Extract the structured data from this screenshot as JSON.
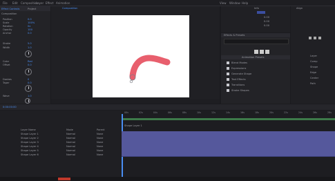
{
  "menu": {
    "items": [
      "File",
      "Edit",
      "Composition",
      "Layer",
      "Effect",
      "Animation",
      "View",
      "Window",
      "Help"
    ]
  },
  "project": {
    "tabs": [
      "Effect Controls",
      "Project"
    ],
    "comp_label": "Composition",
    "properties": [
      {
        "name": "Position",
        "value": "0.0"
      },
      {
        "name": "Scale",
        "value": "100%"
      },
      {
        "name": "Rotation",
        "value": "0x"
      },
      {
        "name": "Opacity",
        "value": "100"
      },
      {
        "name": "Anchor",
        "value": "0.0"
      },
      {
        "name": "Stroke",
        "value": "5.0"
      },
      {
        "name": "Width",
        "value": "1.0"
      },
      {
        "name": "Color",
        "value": "Red"
      },
      {
        "name": "Offset",
        "value": "0.0"
      },
      {
        "name": "Dashes",
        "value": "0"
      },
      {
        "name": "Taper",
        "value": "0.0"
      },
      {
        "name": "Wave",
        "value": "1.0"
      },
      {
        "name": "Angle",
        "value": "0x"
      },
      {
        "name": "Start",
        "value": "0.0"
      },
      {
        "name": "End",
        "value": "100"
      }
    ]
  },
  "viewer": {
    "tab": "Composition"
  },
  "right_panel": {
    "title": "Effects & Presets",
    "search_placeholder": "",
    "section": "Animation Presets",
    "items": [
      "Blend Modes",
      "Expressions",
      "Generate Shape",
      "Text Effects",
      "Transitions",
      "Stroke Shapes"
    ]
  },
  "info_panel": {
    "title": "Info",
    "values": [
      "0.00",
      "0.00",
      "0.00"
    ]
  },
  "preview_panel": {
    "title": "Align",
    "items": [
      "Layer",
      "Comp",
      "Shape",
      "Edge",
      "Center",
      "Path"
    ]
  },
  "timeline": {
    "time": "0:00:00:00",
    "columns": [
      "Layer Name",
      "Mode",
      "Parent"
    ],
    "layers": [
      {
        "name": "Shape Layer 1",
        "mode": "Normal",
        "parent": "None"
      },
      {
        "name": "Shape Layer 2",
        "mode": "Normal",
        "parent": "None"
      },
      {
        "name": "Shape Layer 3",
        "mode": "Normal",
        "parent": "None"
      },
      {
        "name": "Shape Layer 4",
        "mode": "Normal",
        "parent": "None"
      },
      {
        "name": "Shape Layer 5",
        "mode": "Normal",
        "parent": "None"
      },
      {
        "name": "Shape Layer 6",
        "mode": "Normal",
        "parent": "None"
      }
    ],
    "ruler": [
      "00s",
      "02s",
      "04s",
      "06s",
      "08s",
      "10s",
      "12s",
      "14s",
      "16s",
      "18s",
      "20s",
      "22s",
      "24s",
      "26s",
      "28s"
    ],
    "work_area_label": "Shape Layer 1"
  },
  "colors": {
    "accent": "#4a8ff5",
    "shape": "#e85f6d",
    "track": "#55589c",
    "work_area": "#3d7a4a"
  }
}
